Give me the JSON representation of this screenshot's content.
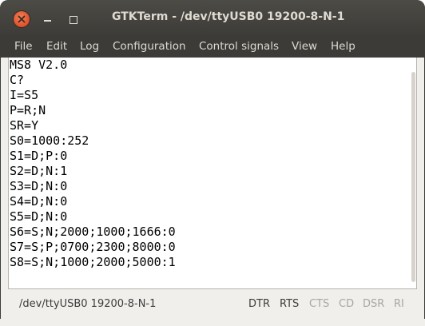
{
  "window": {
    "title": "GTKTerm - /dev/ttyUSB0  19200-8-N-1",
    "controls": {
      "close": "close-icon",
      "minimize": "minimize-icon",
      "maximize": "maximize-icon"
    }
  },
  "menubar": {
    "items": [
      {
        "label": "File"
      },
      {
        "label": "Edit"
      },
      {
        "label": "Log"
      },
      {
        "label": "Configuration"
      },
      {
        "label": "Control signals"
      },
      {
        "label": "View"
      },
      {
        "label": "Help"
      }
    ]
  },
  "terminal": {
    "lines": [
      "MS8 V2.0",
      "C?",
      "I=S5",
      "P=R;N",
      "SR=Y",
      "S0=1000:252",
      "S1=D;P:0",
      "S2=D;N:1",
      "S3=D;N:0",
      "S4=D;N:0",
      "S5=D;N:0",
      "S6=S;N;2000;1000;1666:0",
      "S7=S;P;0700;2300;8000:0",
      "S8=S;N;1000;2000;5000:1"
    ]
  },
  "statusbar": {
    "port": "/dev/ttyUSB0  19200-8-N-1",
    "signals": [
      {
        "label": "DTR",
        "active": true
      },
      {
        "label": "RTS",
        "active": true
      },
      {
        "label": "CTS",
        "active": false
      },
      {
        "label": "CD",
        "active": false
      },
      {
        "label": "DSR",
        "active": false
      },
      {
        "label": "RI",
        "active": false
      }
    ]
  },
  "colors": {
    "titlebar": "#3d3c38",
    "menubar": "#3c3b37",
    "menu_text": "#dfdbd2",
    "close_button": "#e0532d",
    "terminal_bg": "#ffffff",
    "terminal_text": "#000000",
    "signal_on": "#3c3c3c",
    "signal_off": "#a8a6a0"
  }
}
